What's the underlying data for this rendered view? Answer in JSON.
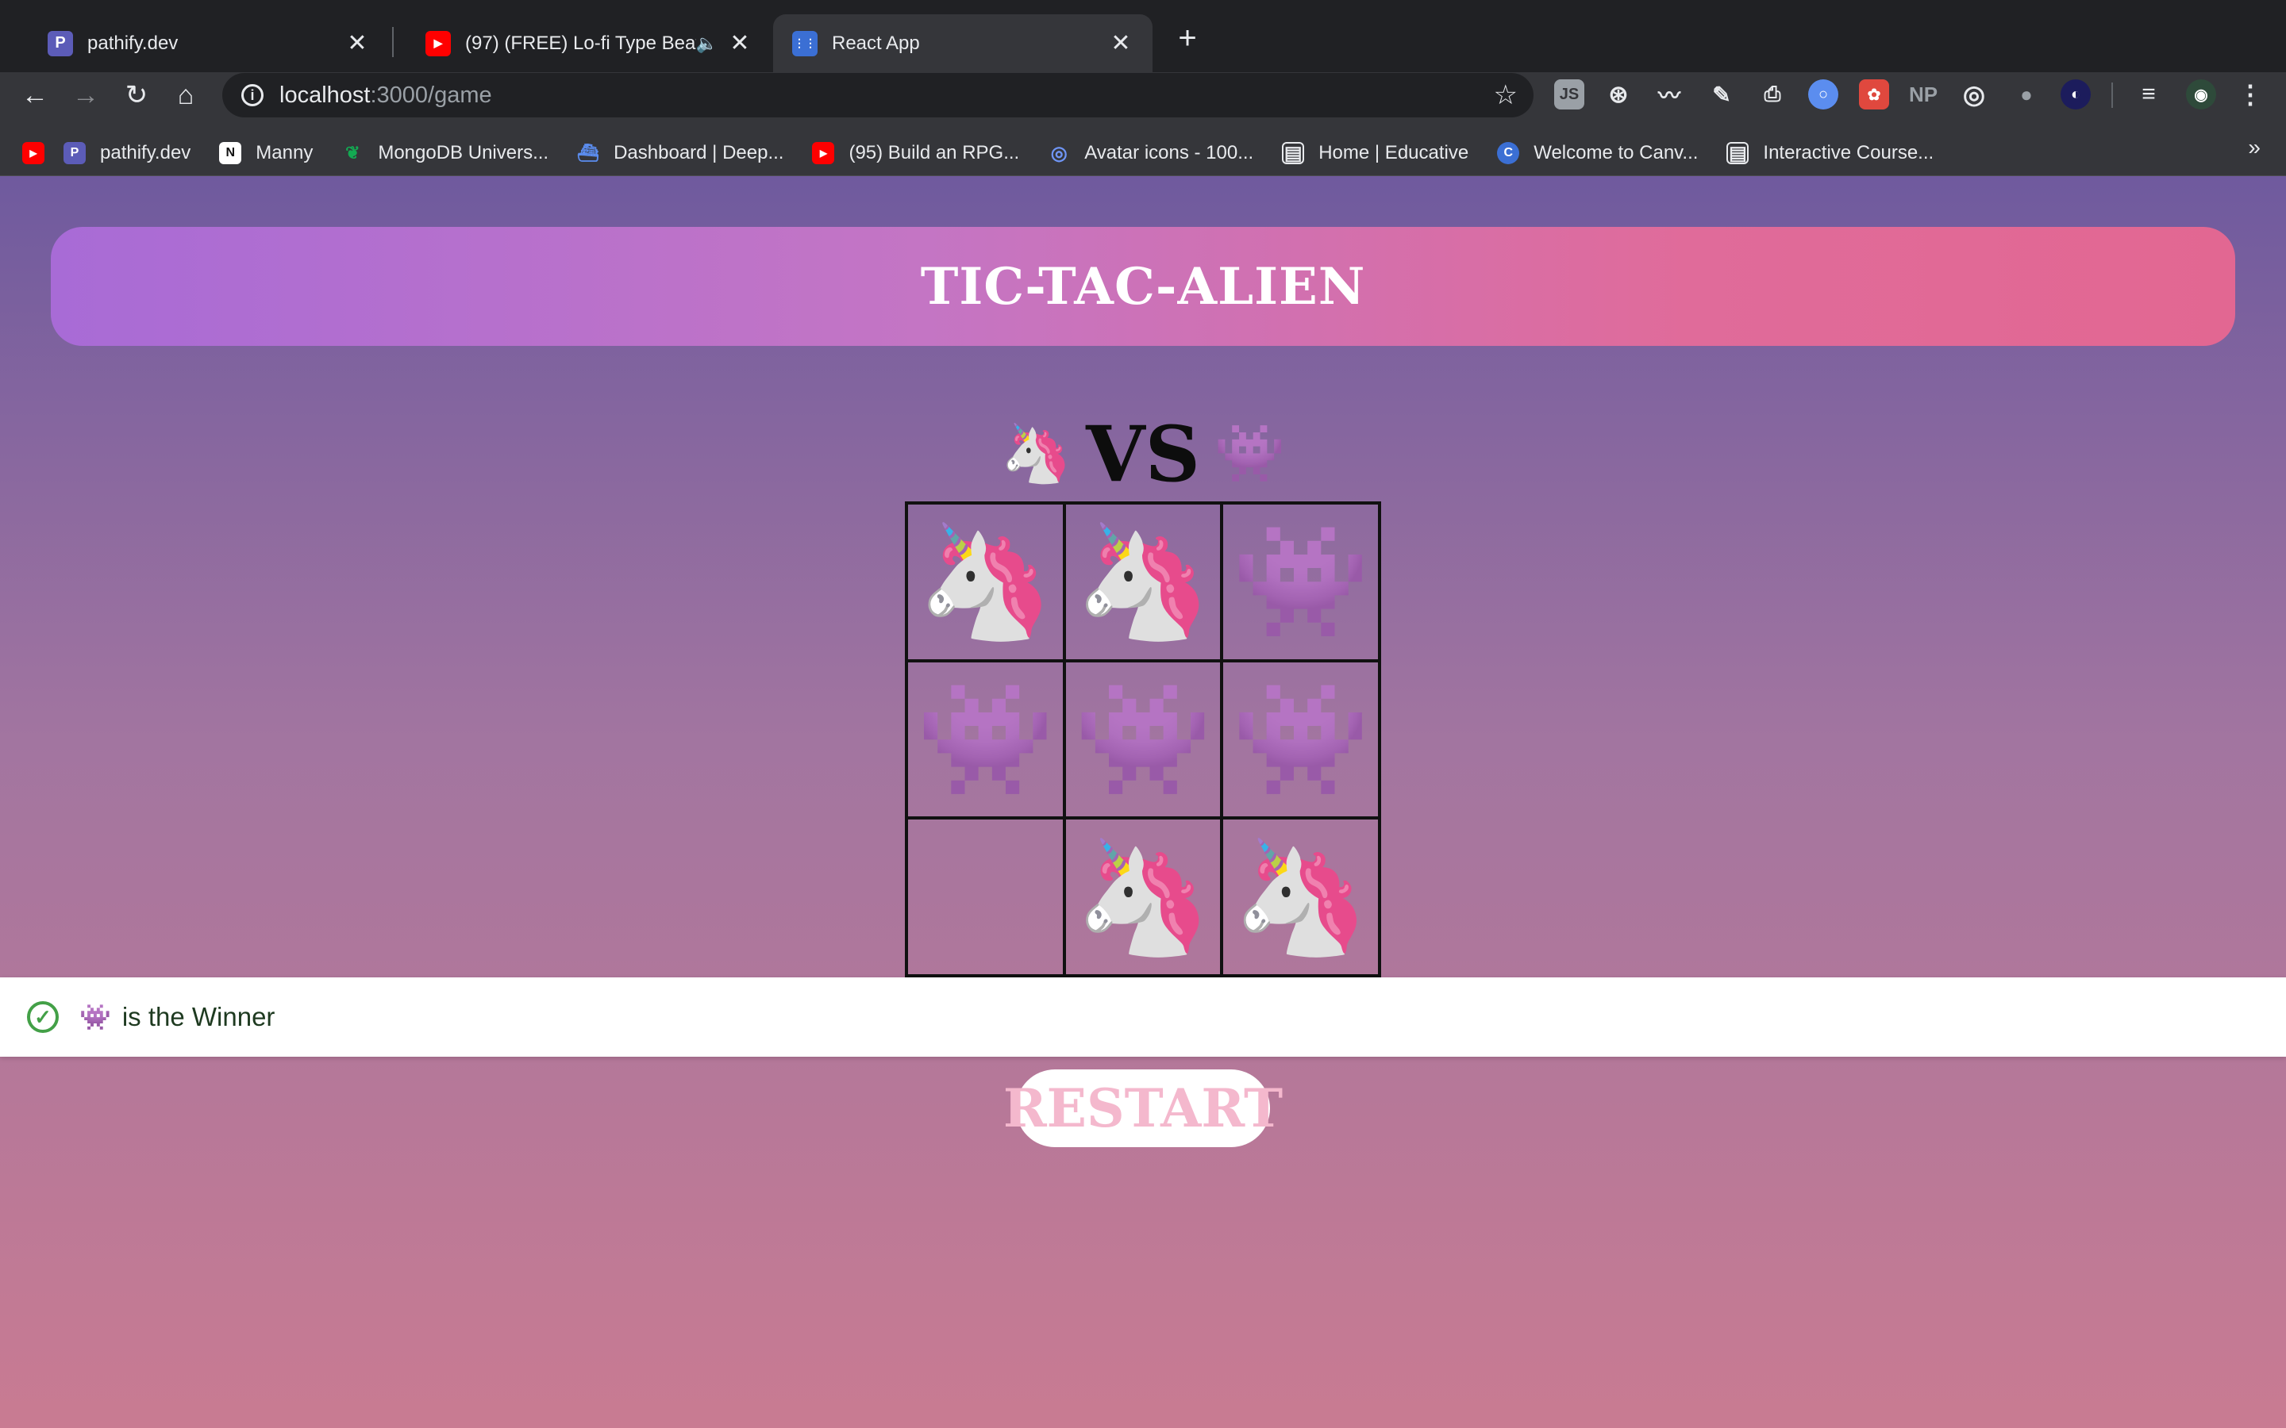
{
  "browser": {
    "tabs": [
      {
        "title": "pathify.dev",
        "icon": "pathify-icon",
        "favicon_letter": "P",
        "color": "#5c5cb8"
      },
      {
        "title": "(97) (FREE) Lo-fi Type Beat",
        "icon": "youtube-icon",
        "favicon_letter": "▶",
        "color": "#ff0000"
      },
      {
        "title": "React App",
        "icon": "react-app-icon",
        "favicon_letter": "⋮⋮",
        "color": "#3b6fd4"
      }
    ],
    "close_glyph": "✕",
    "new_tab_glyph": "+",
    "audio_glyph": "🔈",
    "url_host": "localhost",
    "url_path": ":3000/game",
    "bookmarks": [
      {
        "label": "",
        "icon": "youtube-icon",
        "glyph": "▶",
        "color": "#ff0000"
      },
      {
        "label": "pathify.dev",
        "icon": "pathify-icon",
        "glyph": "P",
        "color": "#5c5cb8"
      },
      {
        "label": "Manny",
        "icon": "notion-icon",
        "glyph": "N",
        "color": "#ffffff"
      },
      {
        "label": "MongoDB Univers...",
        "icon": "mongodb-leaf-icon",
        "glyph": "❦",
        "color": "#13aa52"
      },
      {
        "label": "Dashboard | Deep...",
        "icon": "deepnote-icon",
        "glyph": "⛴",
        "color": "#5b8def"
      },
      {
        "label": "(95) Build an RPG...",
        "icon": "youtube-icon",
        "glyph": "▶",
        "color": "#ff0000"
      },
      {
        "label": "Avatar icons - 100...",
        "icon": "avatar-search-icon",
        "glyph": "◎",
        "color": "#4a7cf0"
      },
      {
        "label": "Home | Educative",
        "icon": "educative-icon",
        "glyph": "▤",
        "color": "#2b2b2b"
      },
      {
        "label": "Welcome to Canv...",
        "icon": "canvas-icon",
        "glyph": "C",
        "color": "#3b6fd4"
      },
      {
        "label": "Interactive Course...",
        "icon": "course-icon",
        "glyph": "▤",
        "color": "#2b2b2b"
      }
    ],
    "bookmarks_more": "»"
  },
  "game": {
    "title": "TIC-TAC-ALIEN",
    "player_one": "🦄",
    "vs_label": "VS",
    "player_two": "👾",
    "board": [
      "🦄",
      "🦄",
      "👾",
      "👾",
      "👾",
      "👾",
      "",
      "🦄",
      "🦄"
    ],
    "restart_label": "RESTART"
  },
  "toast": {
    "winner": "👾",
    "message": "is the Winner",
    "check_glyph": "✓"
  },
  "colors": {
    "banner_start": "#a86bd6",
    "banner_end": "#e26792",
    "toast_success": "#43a047",
    "restart_text": "#f4b8cd"
  }
}
